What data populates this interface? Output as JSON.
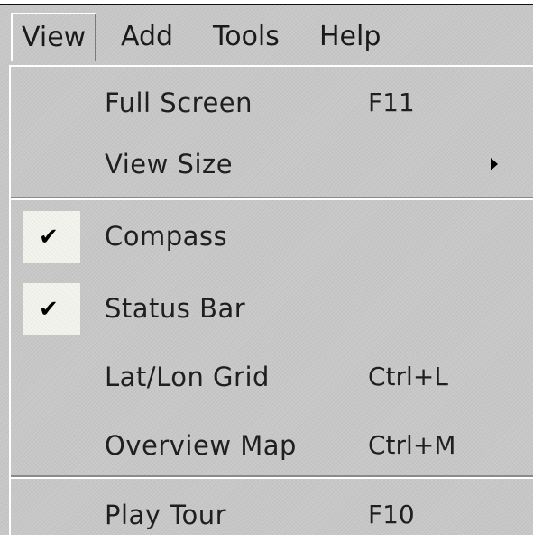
{
  "menubar": {
    "items": [
      {
        "label": "View"
      },
      {
        "label": "Add"
      },
      {
        "label": "Tools"
      },
      {
        "label": "Help"
      }
    ]
  },
  "view_menu": {
    "full_screen": {
      "label": "Full Screen",
      "shortcut": "F11"
    },
    "view_size": {
      "label": "View Size",
      "has_submenu": true
    },
    "compass": {
      "label": "Compass",
      "checked": true,
      "check": "✔"
    },
    "status_bar": {
      "label": "Status Bar",
      "checked": true,
      "check": "✔"
    },
    "lat_lon_grid": {
      "label": "Lat/Lon Grid",
      "shortcut": "Ctrl+L"
    },
    "overview_map": {
      "label": "Overview Map",
      "shortcut": "Ctrl+M"
    },
    "play_tour": {
      "label": "Play Tour",
      "shortcut": "F10"
    }
  },
  "colors": {
    "menu_bg": "#c8c8c8",
    "text": "#1f1f1f",
    "highlight_edge": "#ffffff",
    "shadow_edge": "#8a8a8a",
    "check_bg": "#f4f4ee"
  }
}
